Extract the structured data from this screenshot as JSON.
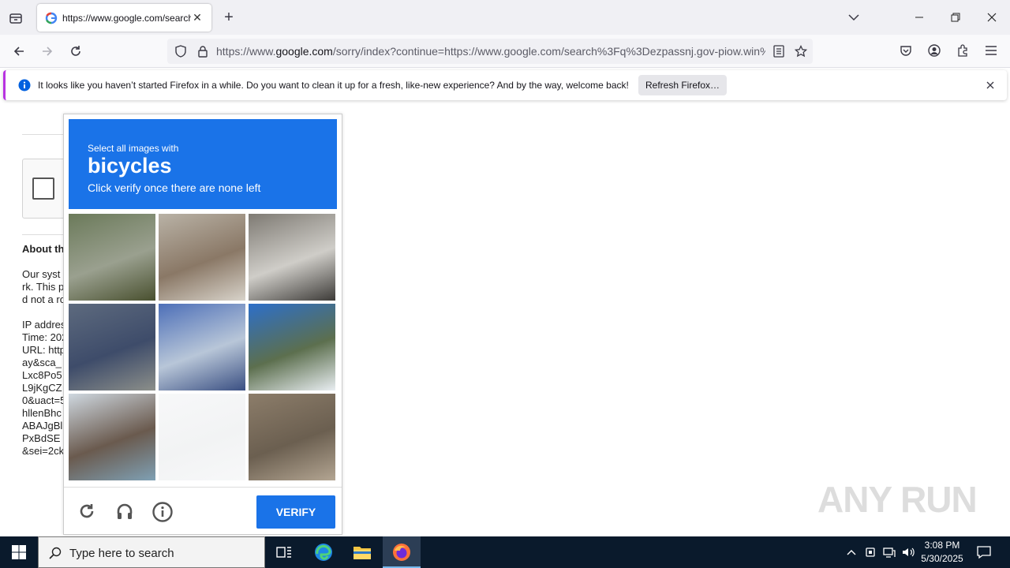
{
  "browser": {
    "tab_title": "https://www.google.com/search",
    "url_prefix": "https://www.",
    "url_domain": "google.com",
    "url_rest": "/sorry/index?continue=https://www.google.com/search%3Fq%3Dezpassnj.gov-piow.win%"
  },
  "notification": {
    "message": "It looks like you haven’t started Firefox in a while. Do you want to clean it up for a fresh, like-new experience? And by the way, welcome back!",
    "button_label": "Refresh Firefox…"
  },
  "page": {
    "about_heading": "About th",
    "lines_a": [
      "Our syst",
      "rk. This p",
      "d not a ro"
    ],
    "lines_b": [
      "IP addres",
      "Time: 202",
      "URL: http",
      "ay&sca_",
      "Lxc8Po5",
      "L9jKgCZ",
      "0&uact=5",
      "hllenBhc",
      "ABAJgBl",
      "PxBdSE",
      "&sei=2ck"
    ]
  },
  "captcha": {
    "instruction_line1": "Select all images with",
    "target": "bicycles",
    "instruction_line3": "Click verify once there are none left",
    "verify_label": "VERIFY",
    "tiles": [
      {
        "name": "tile-1",
        "colors": [
          "#6b7a5a",
          "#9aa08f",
          "#49502f"
        ]
      },
      {
        "name": "tile-2",
        "colors": [
          "#b9b2a6",
          "#8a7866",
          "#d8d3ca"
        ]
      },
      {
        "name": "tile-3",
        "colors": [
          "#7e7a73",
          "#cfcdc8",
          "#3d3b38"
        ]
      },
      {
        "name": "tile-4",
        "colors": [
          "#5d6a7e",
          "#3e4c6a",
          "#8c8f8a"
        ]
      },
      {
        "name": "tile-5",
        "colors": [
          "#4d6fb8",
          "#b8c6d8",
          "#3a4f82"
        ]
      },
      {
        "name": "tile-6",
        "colors": [
          "#2d6fc9",
          "#5c6f4e",
          "#e9eef2"
        ]
      },
      {
        "name": "tile-7",
        "colors": [
          "#cfd8e0",
          "#6a5a4e",
          "#7fa0b4"
        ]
      },
      {
        "name": "tile-8",
        "colors": [
          "#f7f8f9",
          "#f2f3f4",
          "#f7f8f9"
        ]
      },
      {
        "name": "tile-9",
        "colors": [
          "#8c7d6a",
          "#6b5f50",
          "#b3a592"
        ]
      }
    ]
  },
  "taskbar": {
    "search_placeholder": "Type here to search",
    "time": "3:08 PM",
    "date": "5/30/2025"
  },
  "watermark": "ANY RUN",
  "colors": {
    "accent": "#1a73e8",
    "notify_bar": "#b833e1",
    "taskbar": "#0a1a2c"
  }
}
